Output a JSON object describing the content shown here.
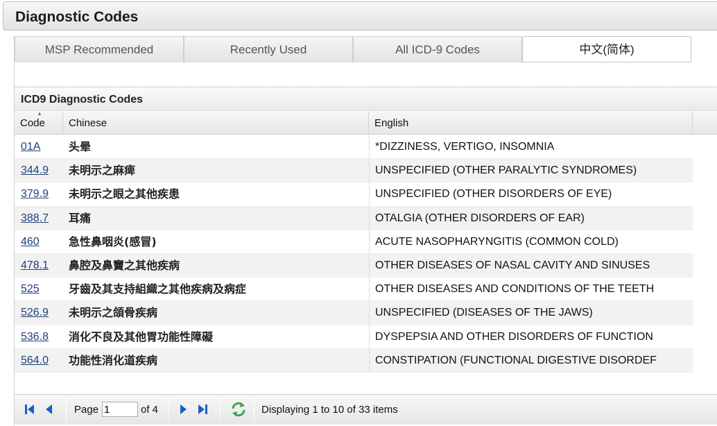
{
  "window": {
    "title": "Diagnostic Codes"
  },
  "tabs": [
    {
      "label": "MSP Recommended",
      "active": false
    },
    {
      "label": "Recently Used",
      "active": false
    },
    {
      "label": "All ICD-9 Codes",
      "active": false
    },
    {
      "label": "中文(简体)",
      "active": true
    }
  ],
  "grid": {
    "title": "ICD9 Diagnostic Codes",
    "columns": [
      "Code",
      "Chinese",
      "English"
    ],
    "rows": [
      {
        "code": "01A",
        "chinese": "头晕",
        "english": "*DIZZINESS, VERTIGO, INSOMNIA"
      },
      {
        "code": "344.9",
        "chinese": "未明示之麻痺",
        "english": "UNSPECIFIED (OTHER PARALYTIC SYNDROMES)"
      },
      {
        "code": "379.9",
        "chinese": "未明示之眼之其他疾患",
        "english": "UNSPECIFIED (OTHER DISORDERS OF EYE)"
      },
      {
        "code": "388.7",
        "chinese": "耳痛",
        "english": "OTALGIA (OTHER DISORDERS OF EAR)"
      },
      {
        "code": "460",
        "chinese": "急性鼻咽炎(感冒)",
        "english": "ACUTE NASOPHARYNGITIS (COMMON COLD)"
      },
      {
        "code": "478.1",
        "chinese": "鼻腔及鼻竇之其他疾病",
        "english": "OTHER DISEASES OF NASAL CAVITY AND SINUSES"
      },
      {
        "code": "525",
        "chinese": "牙齒及其支持組織之其他疾病及病症",
        "english": "OTHER DISEASES AND CONDITIONS OF THE TEETH"
      },
      {
        "code": "526.9",
        "chinese": "未明示之頜骨疾病",
        "english": "UNSPECIFIED (DISEASES OF THE JAWS)"
      },
      {
        "code": "536.8",
        "chinese": "消化不良及其他胃功能性障礙",
        "english": "DYSPEPSIA AND OTHER DISORDERS OF FUNCTION"
      },
      {
        "code": "564.0",
        "chinese": "功能性消化道疾病",
        "english": "CONSTIPATION (FUNCTIONAL DIGESTIVE DISORDEF"
      }
    ]
  },
  "pager": {
    "page_label": "Page",
    "page_value": "1",
    "of_label": "of 4",
    "info": "Displaying 1 to 10 of 33 items",
    "icons": [
      "first-page-icon",
      "prev-page-icon",
      "next-page-icon",
      "last-page-icon",
      "refresh-icon"
    ]
  },
  "colors": {
    "pager_icon": "#1a5fc7",
    "refresh_icon": "#3aa24a",
    "link": "#1f3f7a"
  }
}
